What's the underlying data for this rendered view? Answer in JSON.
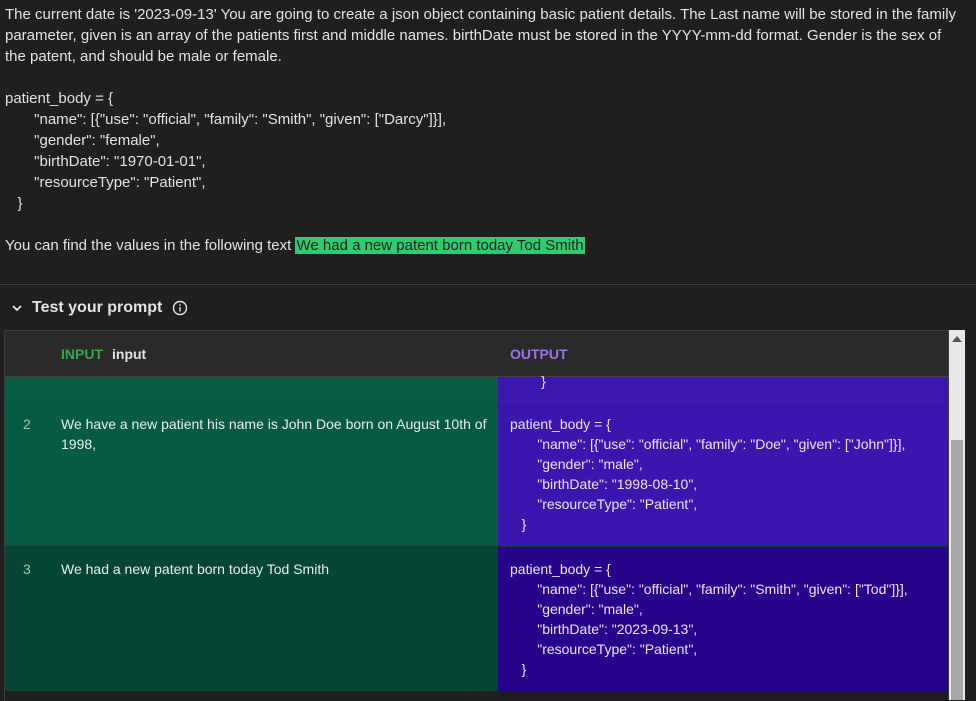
{
  "prompt": {
    "intro": "The current date is '2023-09-13' You are going to create a json object containing basic patient details.  The Last name will be stored in the family parameter,  given is an array of the patients first and middle names.   birthDate must be stored in the YYYY-mm-dd format.  Gender is the sex of the patent, and should be male or female.",
    "code": "patient_body = {\n       \"name\": [{\"use\": \"official\", \"family\": \"Smith\", \"given\": [\"Darcy\"]}],\n       \"gender\": \"female\",\n       \"birthDate\": \"1970-01-01\",\n       \"resourceType\": \"Patient\",\n   }",
    "find_text": "You can find the values in the following text ",
    "highlighted": "We had a new patent born today Tod Smith"
  },
  "test_panel": {
    "title": "Test your prompt",
    "input_header": "INPUT",
    "input_column_name": "input",
    "output_header": "OUTPUT"
  },
  "rows": [
    {
      "num": "",
      "input": "",
      "output": "        }"
    },
    {
      "num": "2",
      "input": "We have a new patient his name is John Doe born on August 10th of 1998,",
      "output": "patient_body = {\n       \"name\": [{\"use\": \"official\", \"family\": \"Doe\", \"given\": [\"John\"]}],\n       \"gender\": \"male\",\n       \"birthDate\": \"1998-08-10\",\n       \"resourceType\": \"Patient\",\n   }"
    },
    {
      "num": "3",
      "input": "We had a new patent born today Tod Smith",
      "output": "patient_body = {\n       \"name\": [{\"use\": \"official\", \"family\": \"Smith\", \"given\": [\"Tod\"]}],\n       \"gender\": \"male\",\n       \"birthDate\": \"2023-09-13\",\n       \"resourceType\": \"Patient\",\n   }"
    }
  ],
  "colors": {
    "highlight": "#2ecc71",
    "input_label": "#34a853",
    "output_label": "#9b72f2"
  },
  "icons": [
    "chevron-down-icon",
    "info-icon",
    "scroll-up-arrow-icon"
  ]
}
